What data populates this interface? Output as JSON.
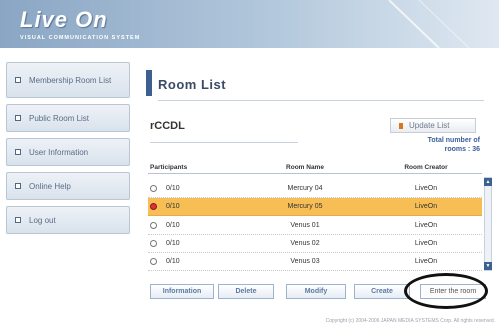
{
  "app": {
    "logo": "Live On",
    "tagline": "VISUAL COMMUNICATION SYSTEM",
    "colors": {
      "header": "#9fb7cf",
      "accent": "#3d5f91",
      "selected_row": "#f6be55",
      "update_icon": "#d8771c"
    }
  },
  "sidebar": {
    "items": [
      {
        "label": "Membership Room List",
        "icon": "square-bullet-icon"
      },
      {
        "label": "Public Room List",
        "icon": "square-bullet-icon"
      },
      {
        "label": "User Information",
        "icon": "square-bullet-icon"
      },
      {
        "label": "Online Help",
        "icon": "square-bullet-icon"
      },
      {
        "label": "Log out",
        "icon": "square-bullet-icon"
      }
    ]
  },
  "main": {
    "title": "Room List",
    "group_name": "rCCDL",
    "update_button": "Update List",
    "total_label": "Total number of",
    "total_value": "rooms : 36",
    "table": {
      "headers": {
        "participants": "Participants",
        "room_name": "Room Name",
        "room_creator": "Room Creator"
      },
      "rows": [
        {
          "participants": "0/10",
          "room_name": "Mercury 04",
          "creator": "LiveOn",
          "selected": false
        },
        {
          "participants": "0/10",
          "room_name": "Mercury 05",
          "creator": "LiveOn",
          "selected": true
        },
        {
          "participants": "0/10",
          "room_name": "Venus 01",
          "creator": "LiveOn",
          "selected": false
        },
        {
          "participants": "0/10",
          "room_name": "Venus 02",
          "creator": "LiveOn",
          "selected": false
        },
        {
          "participants": "0/10",
          "room_name": "Venus 03",
          "creator": "LiveOn",
          "selected": false
        }
      ]
    },
    "actions": {
      "information": "Information",
      "delete": "Delete",
      "modify": "Modify",
      "create": "Create",
      "enter": "Enter the room"
    }
  },
  "footer": {
    "copyright": "Copyright (c) 2004-2006 JAPAN MEDIA SYSTEMS Corp. All rights reserved."
  }
}
